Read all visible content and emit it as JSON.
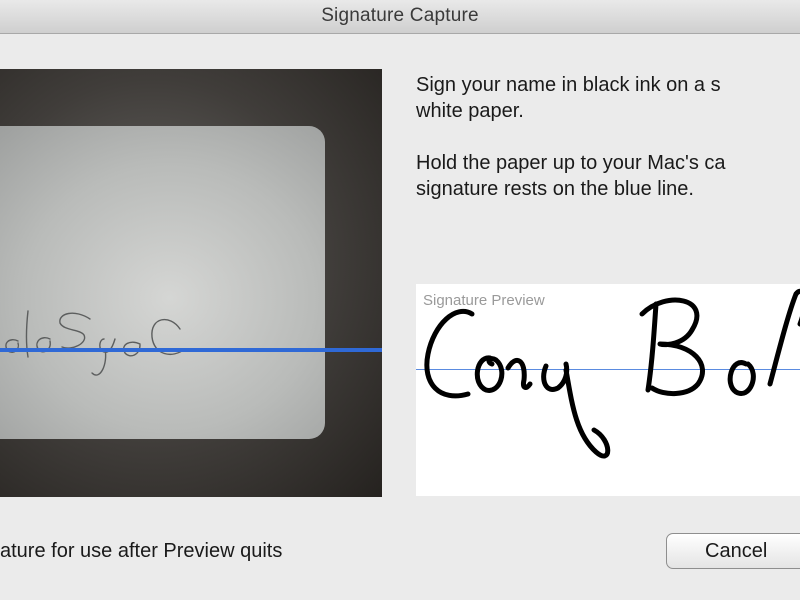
{
  "window": {
    "title": "Signature Capture"
  },
  "instructions": {
    "line1": "Sign your name in black ink on a s",
    "line2": "white paper.",
    "line3": "Hold the paper up to your Mac's ca",
    "line4": "signature rests on the blue line."
  },
  "preview": {
    "label": "Signature Preview"
  },
  "footer": {
    "checkbox_label": "ature for use after Preview quits",
    "cancel_label": "Cancel"
  },
  "colors": {
    "guide_line": "#2f69d6",
    "ink": "#000000"
  }
}
